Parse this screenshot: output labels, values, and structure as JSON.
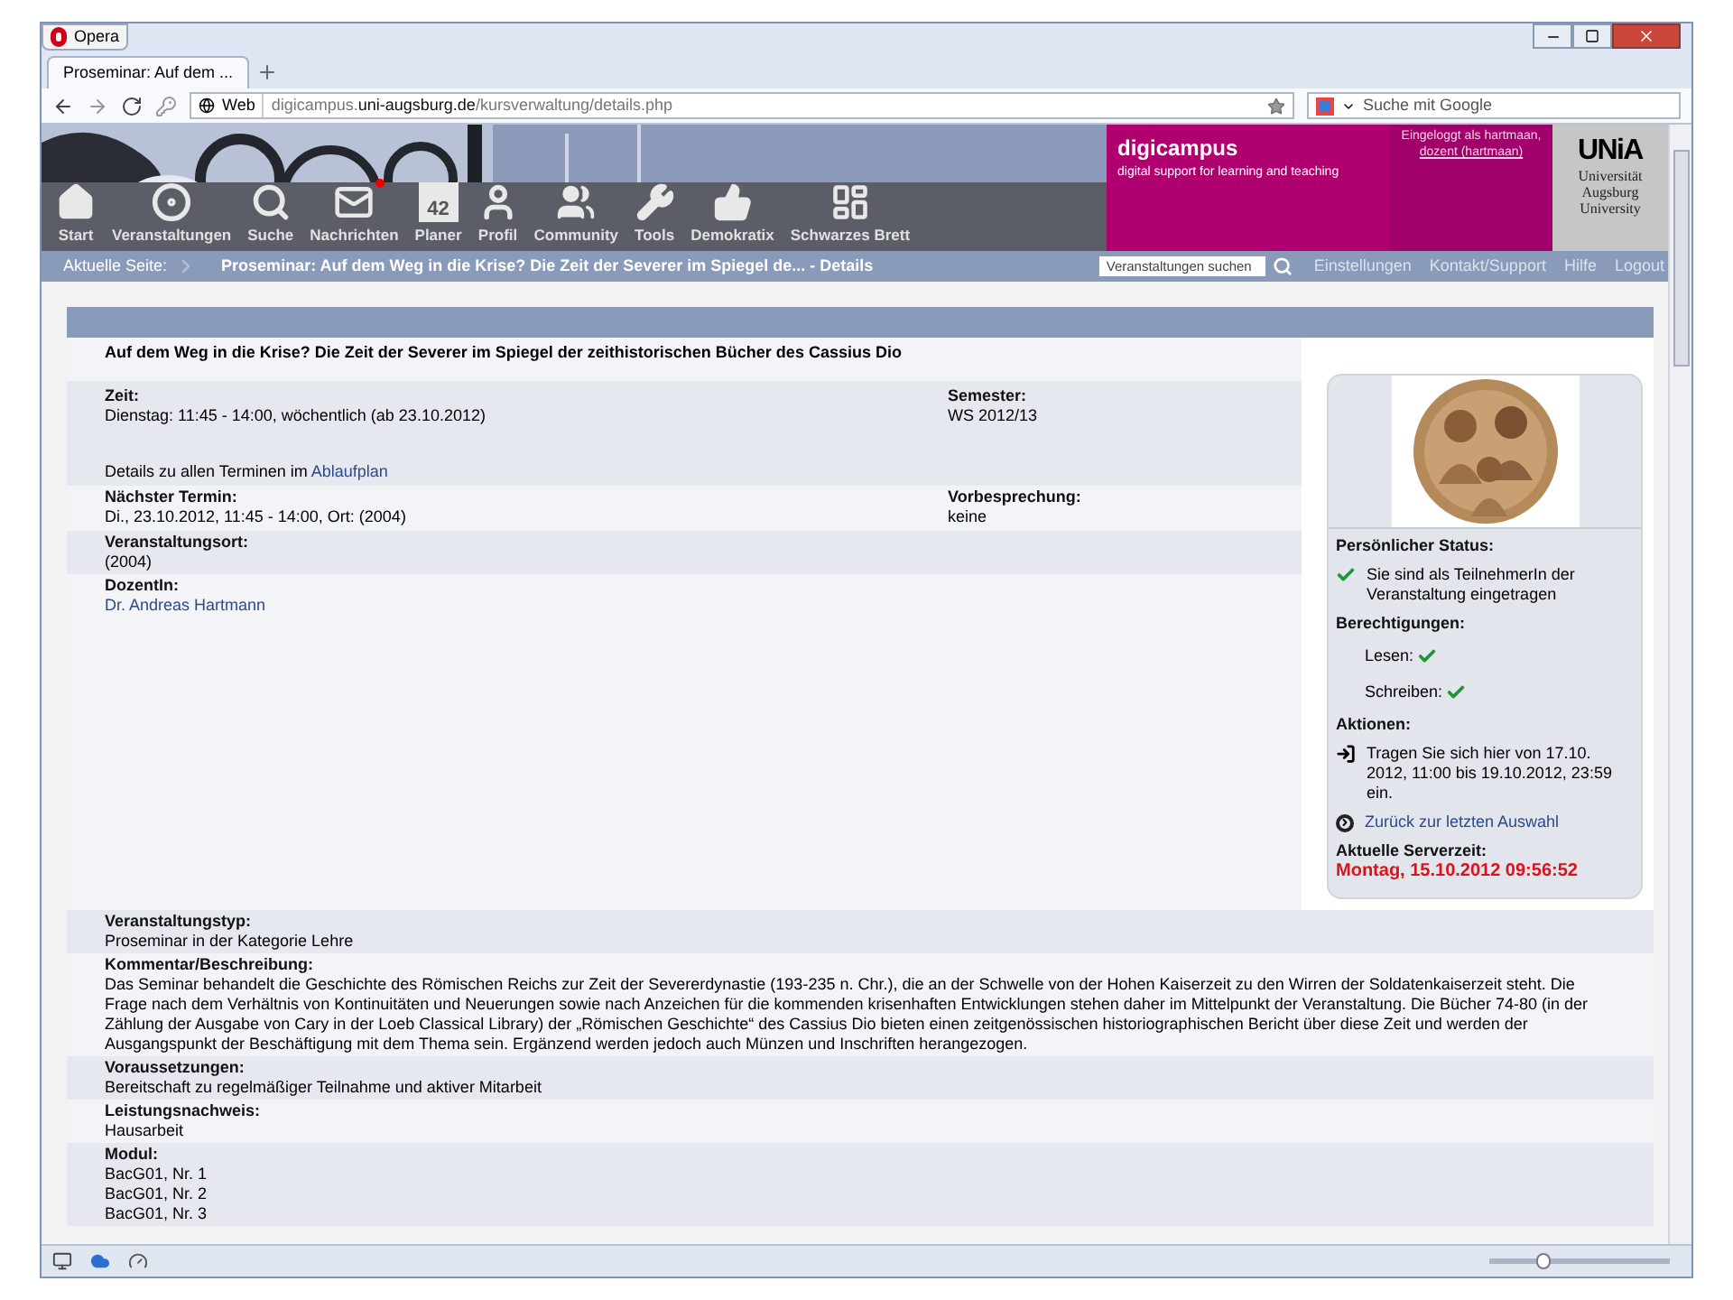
{
  "browser": {
    "menu_button": "Opera",
    "tab": {
      "title": "Proseminar: Auf dem ...",
      "selected": true
    },
    "address": {
      "badge": "Web",
      "host_prefix": "digicampus.",
      "host": "uni-augsburg.de",
      "path": "/kursverwaltung/details.php"
    },
    "search": {
      "placeholder": "Suche mit Google"
    }
  },
  "header": {
    "brand": "digicampus",
    "tagline": "digital support for learning and teaching",
    "login_text": "Eingeloggt als hartmaan,",
    "login_link": "dozent (hartmaan)",
    "logo_mark": "UNiA",
    "logo_lines": [
      "Universität",
      "Augsburg",
      "University"
    ]
  },
  "nav": [
    {
      "kind": "home",
      "label": "Start",
      "unread": false
    },
    {
      "kind": "courses",
      "label": "Veranstaltungen",
      "unread": false
    },
    {
      "kind": "search",
      "label": "Suche",
      "unread": false
    },
    {
      "kind": "mail",
      "label": "Nachrichten",
      "unread": true
    },
    {
      "kind": "calendar",
      "label": "Planer",
      "icon_text": "42",
      "unread": false
    },
    {
      "kind": "profile",
      "label": "Profil",
      "unread": false
    },
    {
      "kind": "community",
      "label": "Community",
      "unread": false
    },
    {
      "kind": "tools",
      "label": "Tools",
      "unread": false
    },
    {
      "kind": "vote",
      "label": "Demokratix",
      "unread": false
    },
    {
      "kind": "board",
      "label": "Schwarzes Brett",
      "unread": false
    }
  ],
  "breadcrumb": {
    "label": "Aktuelle Seite:",
    "title": "Proseminar: Auf dem Weg in die Krise? Die Zeit der Severer im Spiegel de... - Details",
    "search_placeholder": "Veranstaltungen suchen",
    "links": [
      "Einstellungen",
      "Kontakt/Support",
      "Hilfe",
      "Logout"
    ]
  },
  "course": {
    "title": "Auf dem Weg in die Krise? Die Zeit der Severer im Spiegel der zeithistorischen Bücher des Cassius Dio",
    "time": {
      "label": "Zeit:",
      "value": "Dienstag: 11:45 - 14:00, wöchentlich (ab 23.10.2012)",
      "note": "Details zu allen Terminen im",
      "note_link": "Ablaufplan"
    },
    "semester": {
      "label": "Semester:",
      "value": "WS 2012/13"
    },
    "next": {
      "label": "Nächster Termin:",
      "value": "Di., 23.10.2012, 11:45 - 14:00, Ort: (2004)"
    },
    "prelim": {
      "label": "Vorbesprechung:",
      "value": "keine"
    },
    "place": {
      "label": "Veranstaltungsort:",
      "value": "(2004)"
    },
    "lecturer": {
      "label": "DozentIn:",
      "value": "Dr. Andreas Hartmann"
    },
    "sections": [
      {
        "label": "Veranstaltungstyp:",
        "lines": [
          "Proseminar in der Kategorie Lehre"
        ]
      },
      {
        "label": "Kommentar/Beschreibung:",
        "lines": [
          "Das Seminar behandelt die Geschichte des Römischen Reichs zur Zeit der Severerdynastie (193-235 n. Chr.), die an der Schwelle von der Hohen Kaiserzeit zu den Wirren der Soldatenkaiserzeit steht. Die Frage nach dem Verhältnis von Kontinuitäten und Neuerungen sowie nach Anzeichen für die kommenden krisenhaften Entwicklungen stehen daher im Mittelpunkt der Veranstaltung. Die Bücher 74-80 (in der Zählung der Ausgabe von Cary in der Loeb Classical Library) der „Römischen Geschichte“ des Cassius Dio bieten einen zeitgenössischen historiographischen Bericht über diese Zeit und werden der Ausgangspunkt der Beschäftigung mit dem Thema sein. Ergänzend werden jedoch auch Münzen und Inschriften herangezogen."
        ]
      },
      {
        "label": "Voraussetzungen:",
        "lines": [
          "Bereitschaft zu regelmäßiger Teilnahme und aktiver Mitarbeit"
        ]
      },
      {
        "label": "Leistungsnachweis:",
        "lines": [
          "Hausarbeit"
        ]
      },
      {
        "label": "Modul:",
        "lines": [
          "BacG01, Nr. 1",
          "BacG01, Nr. 2",
          "BacG01, Nr. 3"
        ]
      }
    ]
  },
  "sidebar": {
    "status_heading": "Persönlicher Status:",
    "status_text": "Sie sind als TeilnehmerIn der Veranstaltung eingetragen",
    "permissions_heading": "Berechtigungen:",
    "permissions": [
      {
        "label": "Lesen:",
        "granted": true
      },
      {
        "label": "Schreiben:",
        "granted": true
      }
    ],
    "actions_heading": "Aktionen:",
    "action_text": "Tragen Sie sich hier von 17.10. 2012, 11:00 bis 19.10.2012, 23:59 ein.",
    "back_link": "Zurück zur letzten Auswahl",
    "server_time_heading": "Aktuelle Serverzeit:",
    "server_time": "Montag, 15.10.2012 09:56:52"
  },
  "zoom": {
    "level": 0.3
  }
}
